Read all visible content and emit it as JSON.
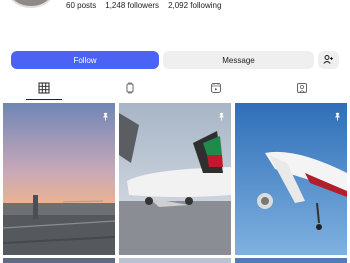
{
  "profile": {
    "posts": "60 posts",
    "followers": "1,248 followers",
    "following": "2,092 following"
  },
  "actions": {
    "follow_label": "Follow",
    "message_label": "Message",
    "suggest_icon": "person-plus-icon"
  },
  "tabs": [
    {
      "name": "grid",
      "icon": "grid-icon",
      "selected": true
    },
    {
      "name": "reels",
      "icon": "reels-icon",
      "selected": false
    },
    {
      "name": "collabs",
      "icon": "collabs-icon",
      "selected": false
    },
    {
      "name": "tagged",
      "icon": "tagged-icon",
      "selected": false
    }
  ],
  "posts": [
    {
      "caption": "",
      "pinned": true
    },
    {
      "caption": "",
      "pinned": true
    },
    {
      "caption": "",
      "pinned": true
    }
  ],
  "colors": {
    "follow_button": "#4a63f5",
    "secondary_button": "#efefef"
  }
}
